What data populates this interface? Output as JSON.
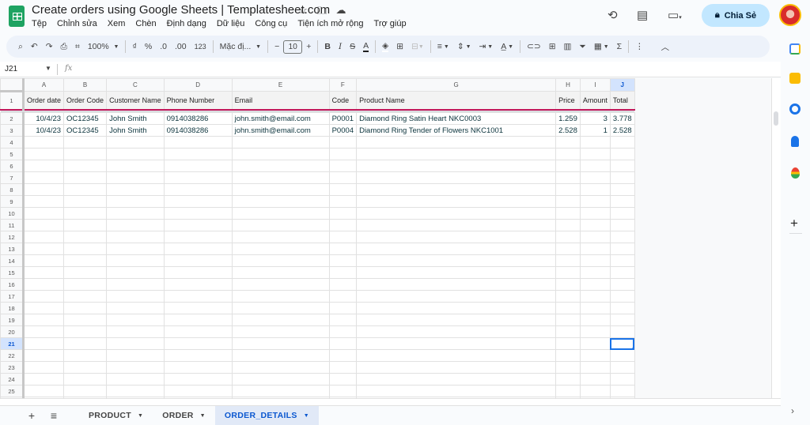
{
  "doc": {
    "title": "Create orders using Google Sheets | Templatesheet.com",
    "title_icons": [
      "star-icon",
      "move-to-folder-icon",
      "cloud-saved-icon"
    ]
  },
  "menu": [
    "Tệp",
    "Chỉnh sửa",
    "Xem",
    "Chèn",
    "Định dạng",
    "Dữ liệu",
    "Công cụ",
    "Tiện ích mở rộng",
    "Trợ giúp"
  ],
  "header_right": {
    "share_label": "Chia Sẻ",
    "icons": [
      "version-history-icon",
      "comments-icon",
      "meet-icon",
      "lock-icon",
      "account-avatar"
    ]
  },
  "toolbar": {
    "zoom": "100%",
    "currency": "₫",
    "percent": "%",
    "dec_decrease": ".0",
    "dec_increase": ".00",
    "more_formats": "123",
    "font": "Mặc đị...",
    "font_size": "10",
    "bold": "B",
    "italic": "I",
    "strike": "S",
    "text_color": "A",
    "sum": "Σ"
  },
  "formula_bar": {
    "name_box": "J21",
    "fx": "fx",
    "value": ""
  },
  "accent": {
    "selection": "#1a73e8",
    "header_underline": "#c2185b",
    "share_bg": "#c2e7ff"
  },
  "sheet": {
    "columns": [
      "A",
      "B",
      "C",
      "D",
      "E",
      "F",
      "G",
      "H",
      "I",
      "J"
    ],
    "selected_column": "J",
    "selected_row": 21,
    "headers": [
      "Order date",
      "Order Code",
      "Customer Name",
      "Phone Number",
      "Email",
      "Code",
      "Product Name",
      "Price",
      "Amount",
      "Total"
    ],
    "rows": [
      [
        "10/4/23",
        "OC12345",
        "John Smith",
        "0914038286",
        "john.smith@email.com",
        "P0001",
        "Diamond Ring Satin Heart NKC0003",
        "1.259",
        "3",
        "3.778"
      ],
      [
        "10/4/23",
        "OC12345",
        "John Smith",
        "0914038286",
        "john.smith@email.com",
        "P0004",
        "Diamond Ring Tender of Flowers NKC1001",
        "2.528",
        "1",
        "2.528"
      ]
    ],
    "visible_rows": 25
  },
  "tabs": {
    "add": "+",
    "all_sheets": "≡",
    "sheets": [
      {
        "label": "PRODUCT",
        "active": false
      },
      {
        "label": "ORDER",
        "active": false
      },
      {
        "label": "ORDER_DETAILS",
        "active": true
      }
    ]
  },
  "side_panel": [
    "calendar-icon",
    "keep-icon",
    "tasks-icon",
    "contacts-icon",
    "maps-icon",
    "add-addon-icon"
  ]
}
